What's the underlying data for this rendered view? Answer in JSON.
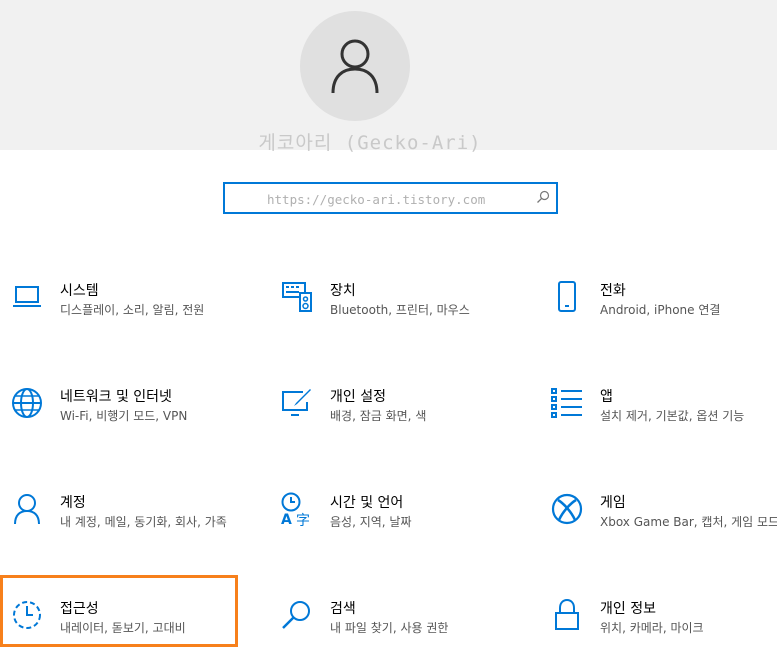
{
  "user": {
    "name": "게코아리 (Gecko-Ari)"
  },
  "search": {
    "placeholder": "https://gecko-ari.tistory.com"
  },
  "colors": {
    "accent": "#0078d7",
    "highlight": "#f7801b"
  },
  "tiles": [
    {
      "title": "시스템",
      "desc": "디스플레이, 소리, 알림, 전원",
      "icon": "laptop-icon"
    },
    {
      "title": "장치",
      "desc": "Bluetooth, 프린터, 마우스",
      "icon": "devices-icon"
    },
    {
      "title": "전화",
      "desc": "Android, iPhone 연결",
      "icon": "phone-icon"
    },
    {
      "title": "네트워크 및 인터넷",
      "desc": "Wi-Fi, 비행기 모드, VPN",
      "icon": "globe-icon"
    },
    {
      "title": "개인 설정",
      "desc": "배경, 잠금 화면, 색",
      "icon": "personalize-icon"
    },
    {
      "title": "앱",
      "desc": "설치 제거, 기본값, 옵션 기능",
      "icon": "apps-icon"
    },
    {
      "title": "계정",
      "desc": "내 계정, 메일, 동기화, 회사, 가족",
      "icon": "person-icon"
    },
    {
      "title": "시간 및 언어",
      "desc": "음성, 지역, 날짜",
      "icon": "time-language-icon"
    },
    {
      "title": "게임",
      "desc": "Xbox Game Bar, 캡처, 게임 모드",
      "icon": "xbox-icon"
    },
    {
      "title": "접근성",
      "desc": "내레이터, 돋보기, 고대비",
      "icon": "accessibility-icon"
    },
    {
      "title": "검색",
      "desc": "내 파일 찾기, 사용 권한",
      "icon": "search-icon"
    },
    {
      "title": "개인 정보",
      "desc": "위치, 카메라, 마이크",
      "icon": "lock-icon"
    }
  ]
}
